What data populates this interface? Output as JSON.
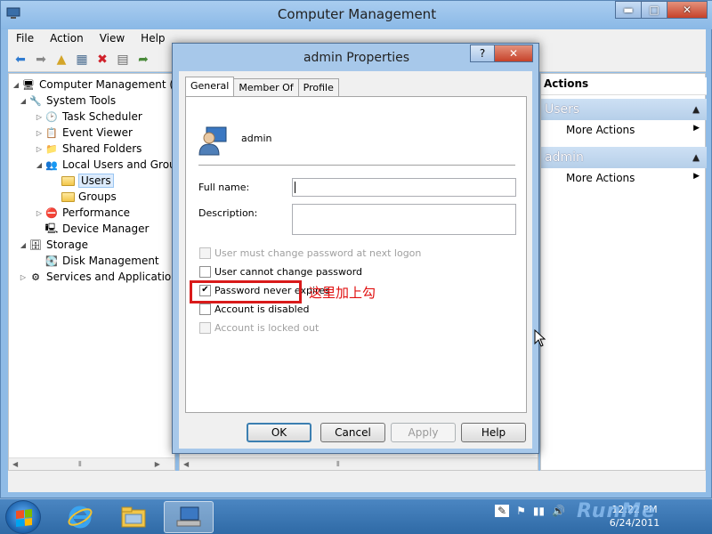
{
  "window": {
    "title": "Computer Management",
    "minimize": "▬",
    "maximize": "□",
    "close": "✕"
  },
  "menu": [
    "File",
    "Action",
    "View",
    "Help"
  ],
  "tree": {
    "root": "Computer Management (Local)",
    "system_tools": "System Tools",
    "task_scheduler": "Task Scheduler",
    "event_viewer": "Event Viewer",
    "shared_folders": "Shared Folders",
    "local_users_groups": "Local Users and Groups",
    "users": "Users",
    "groups": "Groups",
    "performance": "Performance",
    "device_manager": "Device Manager",
    "storage": "Storage",
    "disk_management": "Disk Management",
    "services_apps": "Services and Applications"
  },
  "actions": {
    "header": "Actions",
    "section1": "Users",
    "section1_link": "More Actions",
    "section2": "admin",
    "section2_link": "More Actions"
  },
  "dialog": {
    "title": "admin Properties",
    "help": "?",
    "close": "✕",
    "tabs": [
      "General",
      "Member Of",
      "Profile"
    ],
    "username": "admin",
    "full_name_label": "Full name:",
    "full_name_value": "",
    "description_label": "Description:",
    "description_value": "",
    "options": [
      {
        "label": "User must change password at next logon",
        "checked": false,
        "disabled": true
      },
      {
        "label": "User cannot change password",
        "checked": false,
        "disabled": false
      },
      {
        "label": "Password never expires",
        "checked": true,
        "disabled": false
      },
      {
        "label": "Account is disabled",
        "checked": false,
        "disabled": false
      },
      {
        "label": "Account is locked out",
        "checked": false,
        "disabled": true
      }
    ],
    "buttons": {
      "ok": "OK",
      "cancel": "Cancel",
      "apply": "Apply",
      "help": "Help"
    }
  },
  "annotation": "这里加上勾",
  "taskbar": {
    "time": "12:22 PM",
    "date": "6/24/2011"
  },
  "watermark": "RunMe",
  "colors": {
    "highlight": "#d91a1a",
    "accent": "#3c7fb1"
  }
}
